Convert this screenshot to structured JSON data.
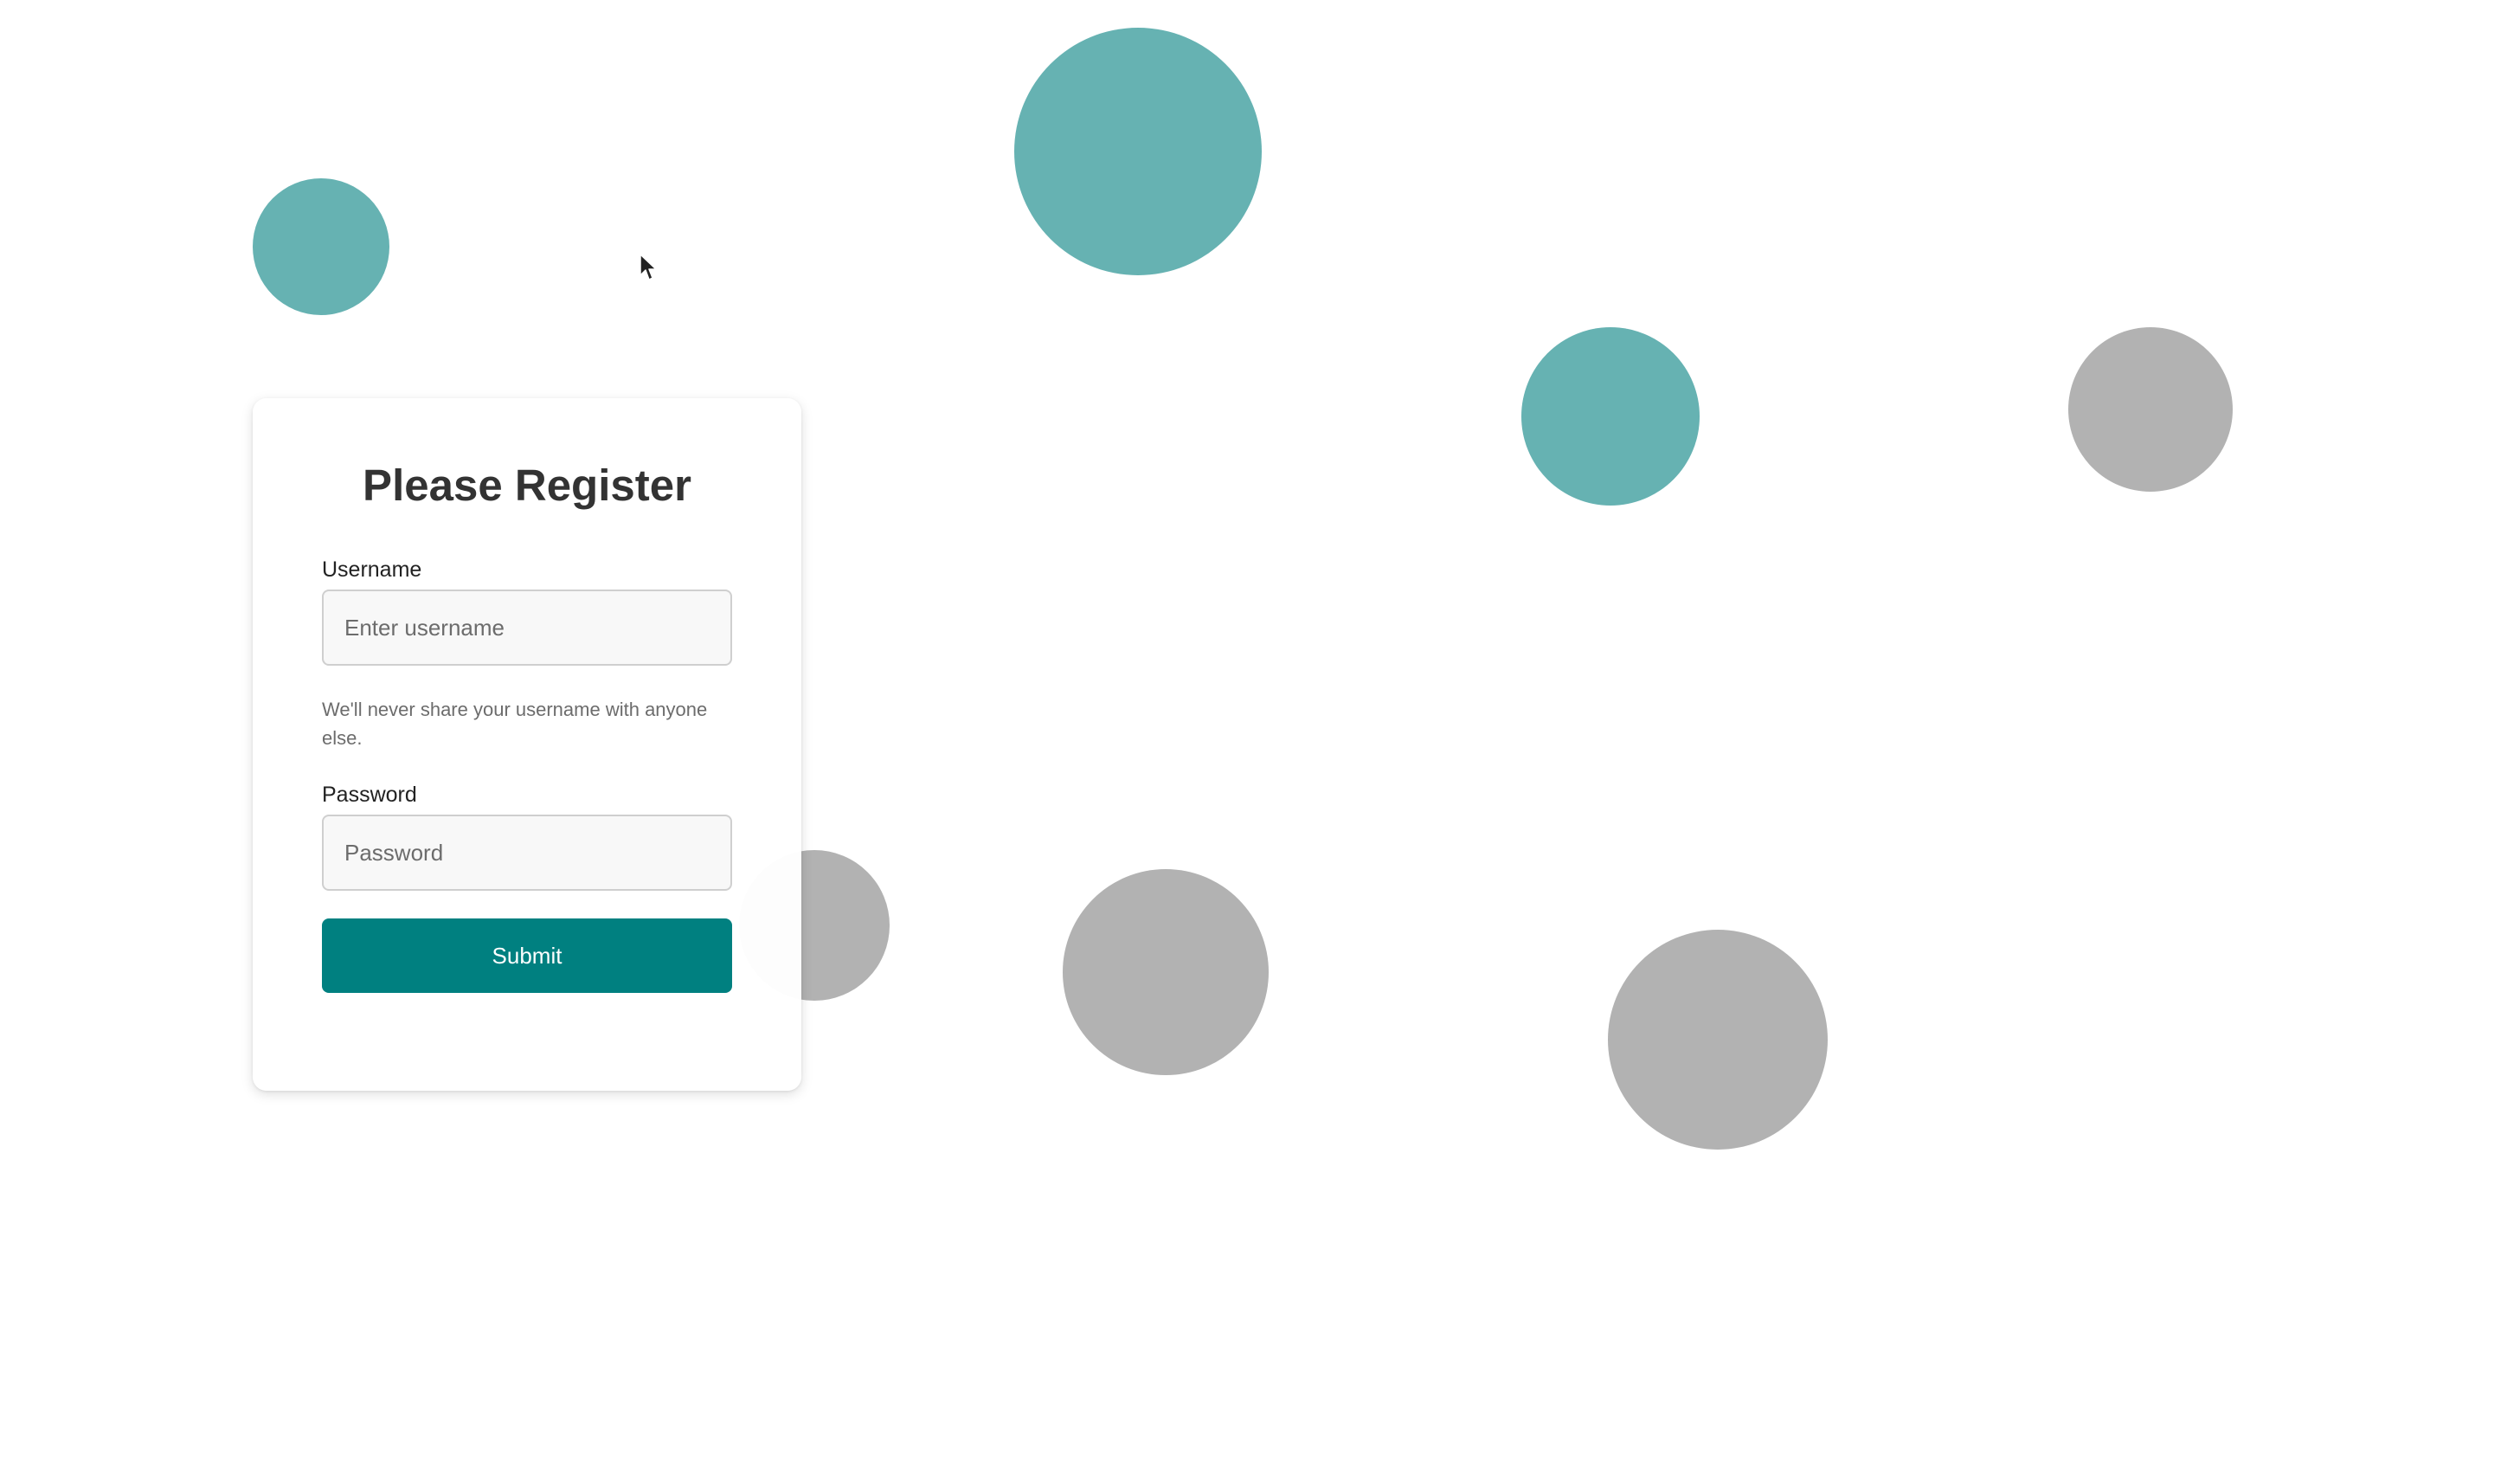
{
  "form": {
    "title": "Please Register",
    "username_label": "Username",
    "username_placeholder": "Enter username",
    "username_value": "",
    "help_text": "We'll never share your username with anyone else.",
    "password_label": "Password",
    "password_placeholder": "Password",
    "password_value": "",
    "submit_label": "Submit"
  },
  "theme": {
    "accent": "#008080",
    "circle_teal": "#66b2b2",
    "circle_gray": "#b2b2b2",
    "background": "#ffffff"
  },
  "decorations": {
    "circle_count": 9,
    "cursor_icon": "mouse-pointer-icon"
  }
}
